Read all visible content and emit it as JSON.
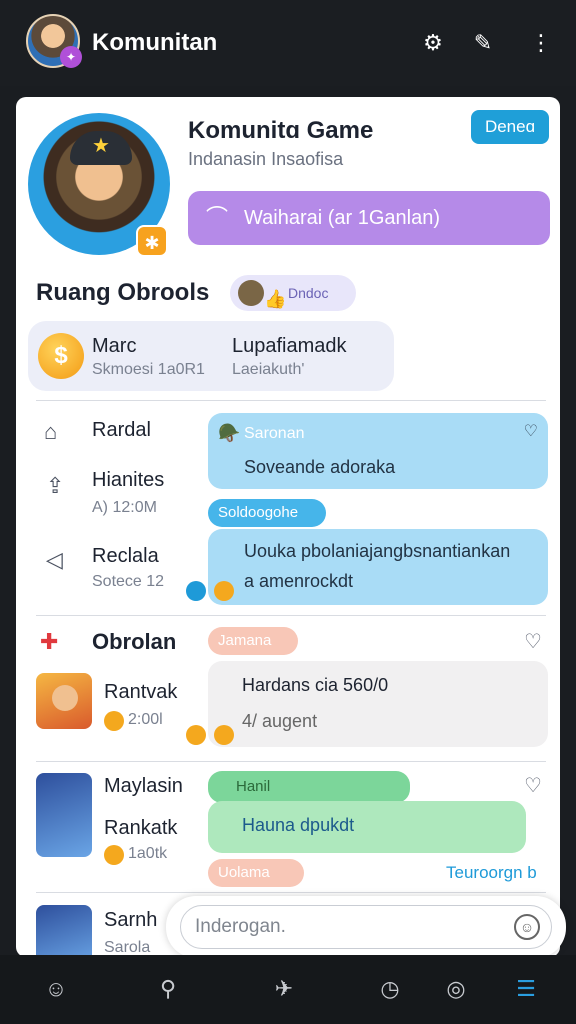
{
  "app_bar": {
    "title": "Komunitan"
  },
  "group": {
    "title": "Komunitɑ Game",
    "subtitle": "Indanasin Insaofisa",
    "top_button": "Deneɑ",
    "primary_button": "Waiharai (ar 1Ganlan)"
  },
  "section": {
    "title": "Ruang Obrools",
    "pill_label": "Dndoc"
  },
  "pinned": {
    "left_name": "Marc",
    "left_sub": "Skmoesi 1a0R1",
    "right_name": "Lupafiamadk",
    "right_sub": "Laeiakuth'"
  },
  "rows_block1": [
    {
      "name": "Rardal",
      "sub": ""
    },
    {
      "name": "Hianites",
      "sub": "A) 12:0M"
    },
    {
      "name": "Reclala",
      "sub": "Sotece 12"
    }
  ],
  "msg_block1": {
    "bubble1_header": "Saronan",
    "bubble1_text": "Soveande adoraka",
    "chip": "Soldoogohe",
    "bubble2_line1": "Uouka pbolaniajangbsnantiankan",
    "bubble2_line2": "a amenrockdt"
  },
  "obrolan": {
    "title": "Obrolan",
    "row_name": "Rantvak",
    "row_sub": "2:00l",
    "chip": "Jamana",
    "bubble_line1": "Hardans cia 560/0",
    "bubble_line2": "4/ augent"
  },
  "block3": {
    "name1": "Maylasin",
    "name2": "Rankatk",
    "sub2": "1a0tk",
    "chip": "Hanil",
    "bubble_text": "Hauna dpukdt",
    "chip2": "Uolama",
    "link": "Teuroorgn b"
  },
  "block4": {
    "name": "Sarnh",
    "sub": "Sarola"
  },
  "input": {
    "placeholder": "Inderogan."
  }
}
